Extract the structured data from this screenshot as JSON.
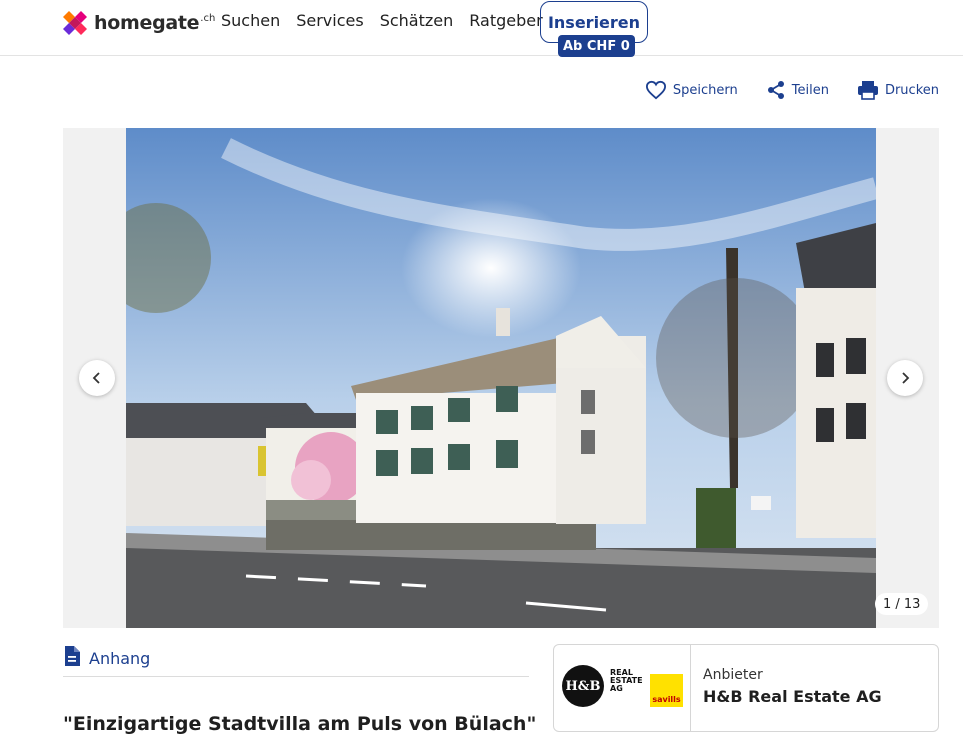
{
  "header": {
    "logo_text": "homegate",
    "logo_tld": ".ch",
    "nav": [
      "Suchen",
      "Services",
      "Schätzen",
      "Ratgeber"
    ],
    "cta_label": "Inserieren",
    "cta_badge": "Ab CHF 0"
  },
  "actions": {
    "save": "Speichern",
    "share": "Teilen",
    "print": "Drucken"
  },
  "gallery": {
    "counter": "1 / 13"
  },
  "attachment": {
    "label": "Anhang"
  },
  "listing": {
    "title": "\"Einzigartige Stadtvilla am Puls von Bülach\""
  },
  "provider": {
    "kicker": "Anbieter",
    "name": "H&B Real Estate AG",
    "logo_initials": "H&B",
    "logo_text": "REAL ESTATE AG",
    "partner_logo": "savills"
  },
  "colors": {
    "brand_blue": "#1c3f8f",
    "logo_pink": "#e5007d",
    "logo_orange": "#ff7a00",
    "logo_purple": "#6b2bd9"
  }
}
